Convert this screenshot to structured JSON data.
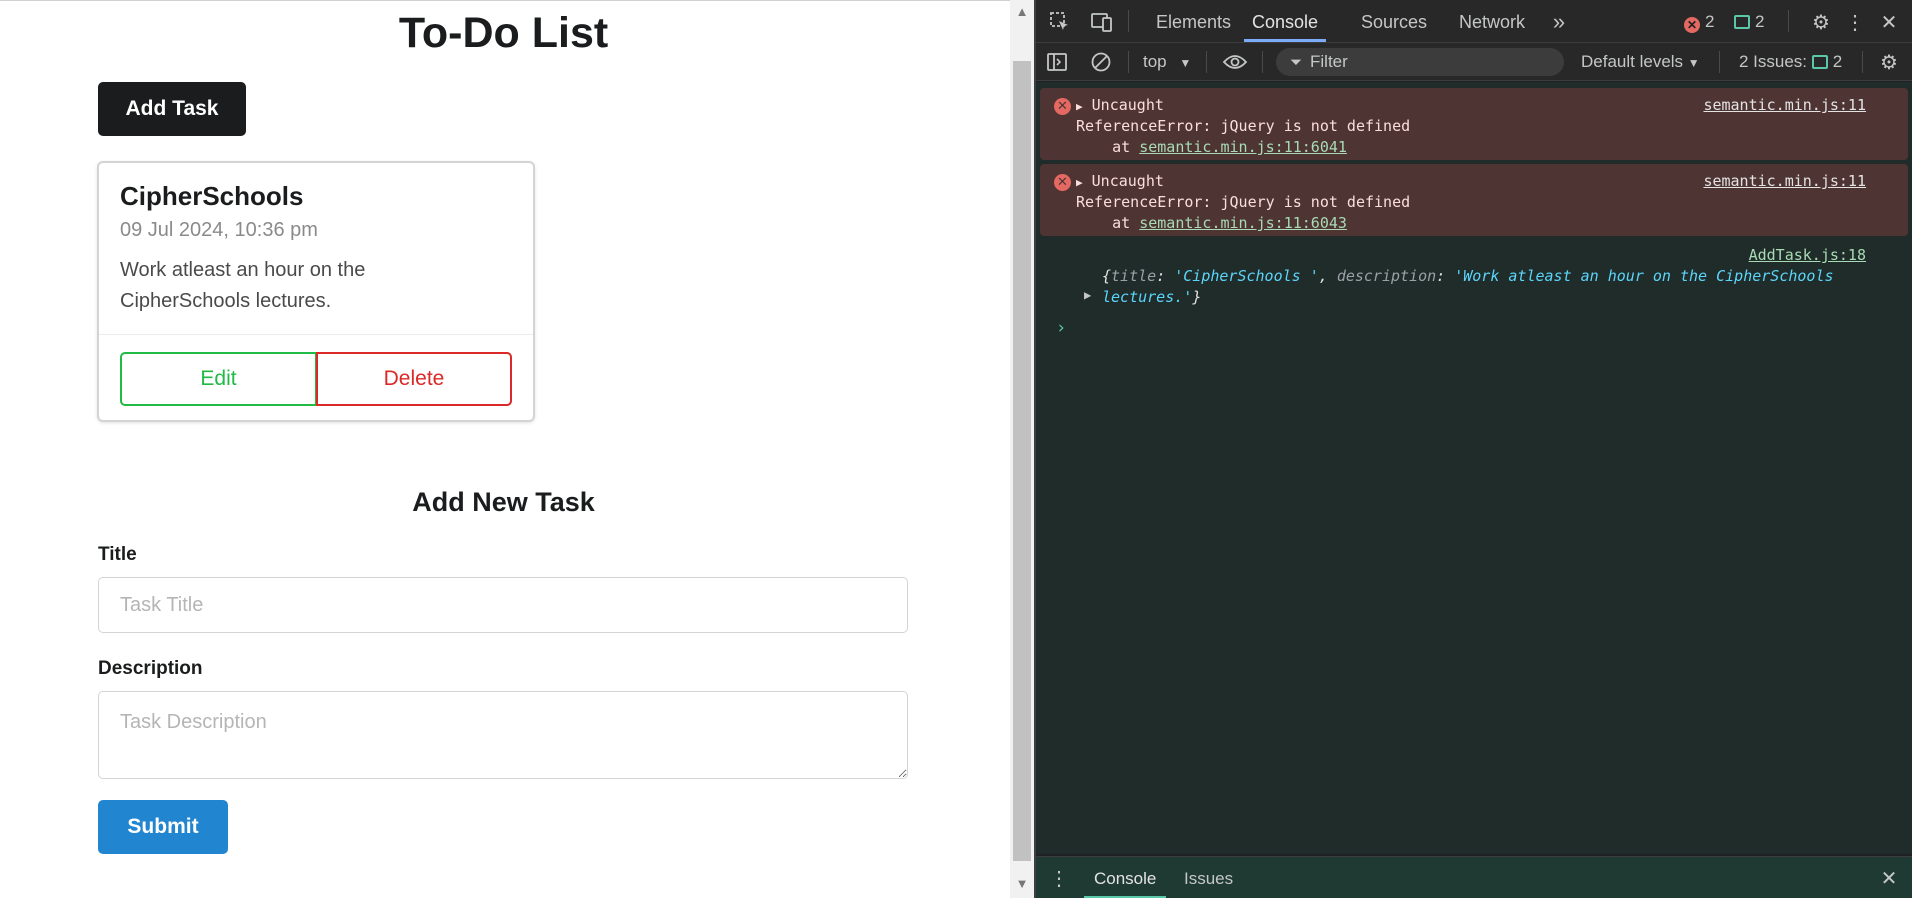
{
  "app": {
    "title": "To-Do List",
    "add_task_label": "Add Task",
    "task_card": {
      "title": "CipherSchools",
      "date": "09 Jul 2024, 10:36 pm",
      "description": "Work atleast an hour on the CipherSchools lectures.",
      "edit_label": "Edit",
      "delete_label": "Delete"
    },
    "form": {
      "heading": "Add New Task",
      "title_label": "Title",
      "title_placeholder": "Task Title",
      "description_label": "Description",
      "description_placeholder": "Task Description",
      "submit_label": "Submit"
    }
  },
  "devtools": {
    "tabs": [
      "Elements",
      "Console",
      "Sources",
      "Network"
    ],
    "active_tab": "Console",
    "error_count": "2",
    "message_count": "2",
    "context": "top",
    "filter_placeholder": "Filter",
    "levels": "Default levels",
    "issues_label": "2 Issues:",
    "issues_count": "2",
    "console": {
      "errors": [
        {
          "head": "Uncaught",
          "message": "ReferenceError: jQuery is not defined",
          "at": "    at ",
          "location_link": "semantic.min.js:11:6041",
          "source": "semantic.min.js:11"
        },
        {
          "head": "Uncaught",
          "message": "ReferenceError: jQuery is not defined",
          "at": "    at ",
          "location_link": "semantic.min.js:11:6043",
          "source": "semantic.min.js:11"
        }
      ],
      "log": {
        "source": "AddTask.js:18",
        "key1": "title",
        "val1": "'CipherSchools '",
        "key2": "description",
        "val2": "'Work atleast an hour on the CipherSchools lectures.'"
      },
      "prompt": "›"
    },
    "drawer_tabs": [
      "Console",
      "Issues"
    ]
  },
  "colors": {
    "primary": "#2185d0",
    "edit_green": "#21ba45",
    "delete_red": "#db2828",
    "error_bg": "#4e3534"
  }
}
